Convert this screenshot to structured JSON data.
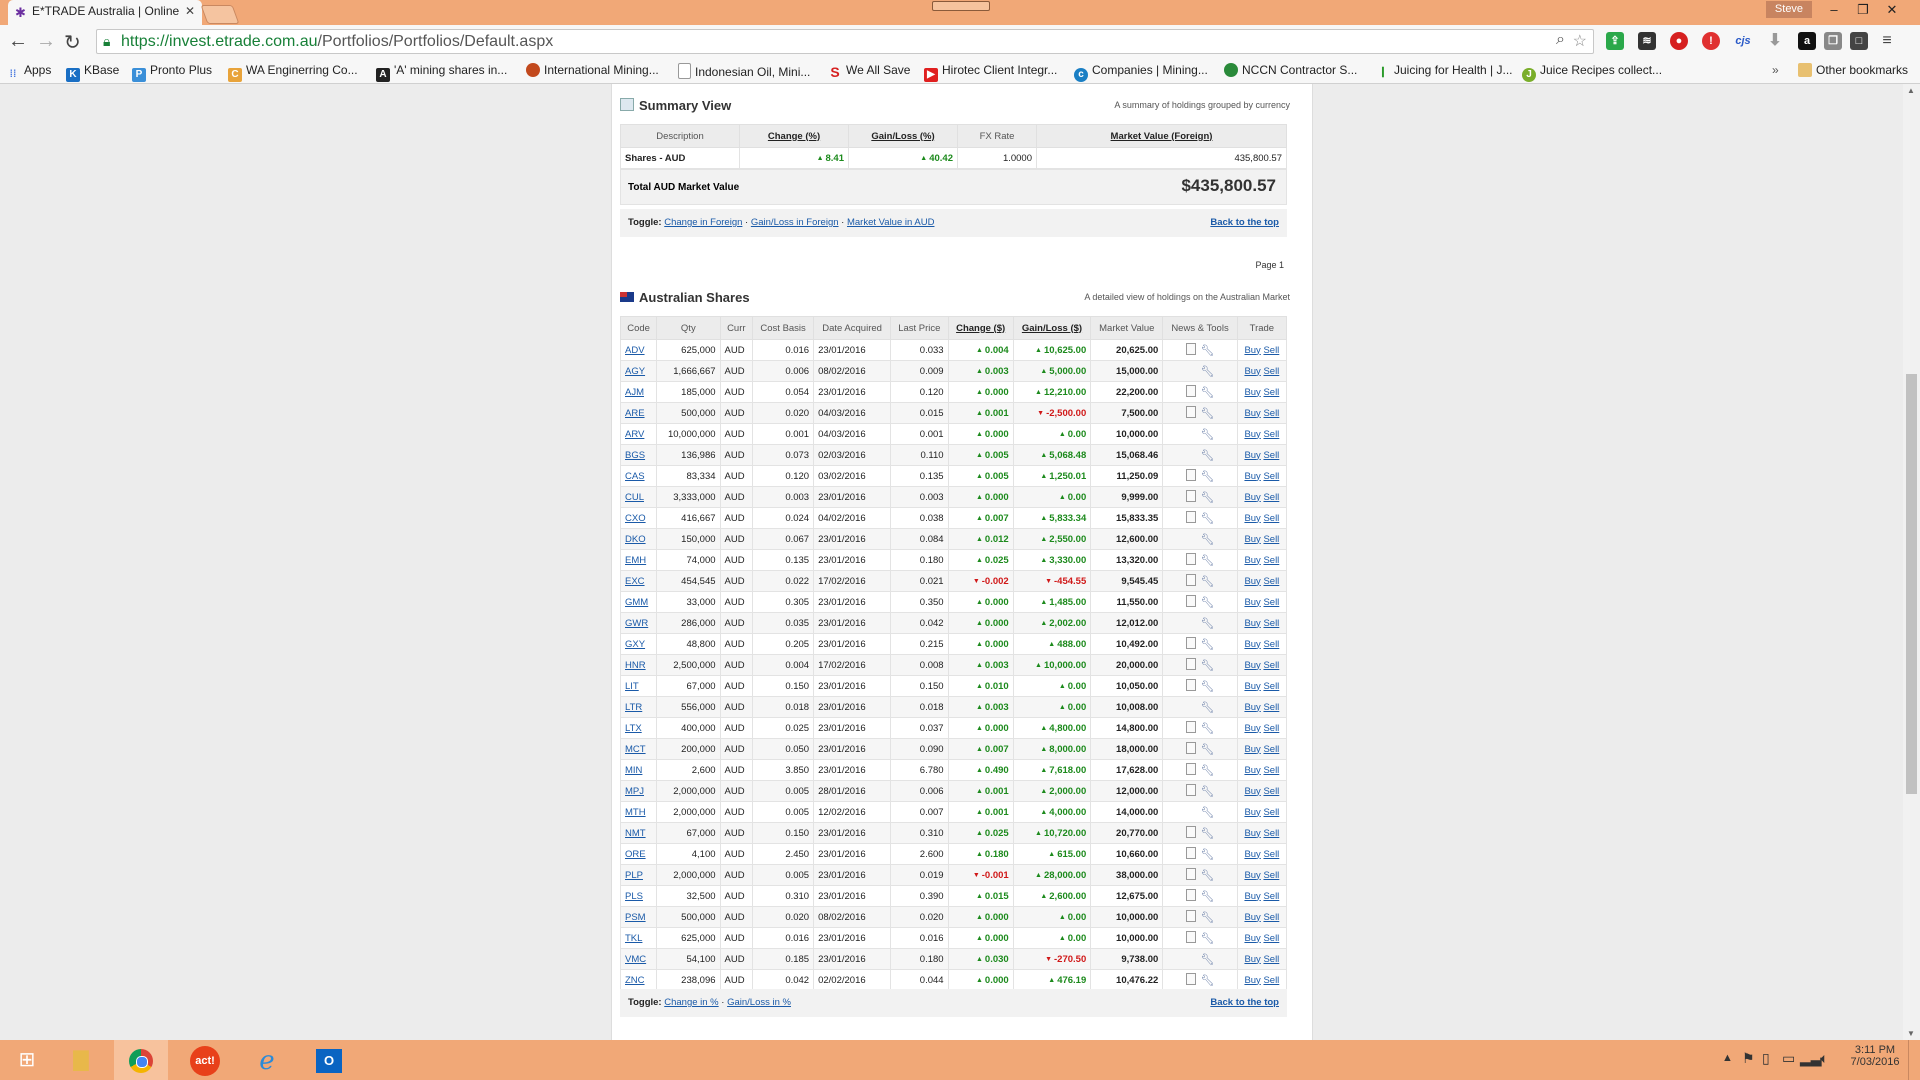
{
  "browser": {
    "tab_title": "E*TRADE Australia | Online",
    "url_host": "https://invest.etrade.com.au",
    "url_path": "/Portfolios/Portfolios/Default.aspx",
    "user": "Steve"
  },
  "bookmarks": [
    {
      "label": "Apps",
      "color": "#e94235"
    },
    {
      "label": "KBase",
      "color": "#1a6fc4"
    },
    {
      "label": "Pronto Plus",
      "color": "#3a8fd8"
    },
    {
      "label": "WA Enginerring Co...",
      "color": "#e8a33a"
    },
    {
      "label": "'A' mining shares in...",
      "color": "#222222"
    },
    {
      "label": "International Mining...",
      "color": "#c2491d"
    },
    {
      "label": "Indonesian Oil, Mini...",
      "color": "#9a9a9a"
    },
    {
      "label": "We All Save",
      "color": "#d62020"
    },
    {
      "label": "Hirotec Client Integr...",
      "color": "#e02020"
    },
    {
      "label": "Companies | Mining...",
      "color": "#1a7fc4"
    },
    {
      "label": "NCCN Contractor S...",
      "color": "#2a8a3a"
    },
    {
      "label": "Juicing for Health | J...",
      "color": "#2a9a2a"
    },
    {
      "label": "Juice Recipes collect...",
      "color": "#7aae2a"
    }
  ],
  "other_bookmarks": "Other bookmarks",
  "summary": {
    "title": "Summary View",
    "desc": "A summary of holdings grouped by currency",
    "headers": [
      "Description",
      "Change (%)",
      "Gain/Loss (%)",
      "FX Rate",
      "Market Value (Foreign)"
    ],
    "row": {
      "desc": "Shares - AUD",
      "change": "8.41",
      "gain": "40.42",
      "fx": "1.0000",
      "value": "435,800.57"
    },
    "total_label": "Total AUD Market Value",
    "total_value": "$435,800.57",
    "toggle_label": "Toggle:",
    "toggles": [
      "Change in Foreign",
      "Gain/Loss in Foreign",
      "Market Value in AUD"
    ],
    "back_top": "Back to the top"
  },
  "page_label": "Page 1",
  "shares": {
    "title": "Australian Shares",
    "desc": "A detailed view of holdings on the Australian Market",
    "headers": [
      "Code",
      "Qty",
      "Curr",
      "Cost Basis",
      "Date Acquired",
      "Last Price",
      "Change ($)",
      "Gain/Loss ($)",
      "Market Value",
      "News & Tools",
      "Trade"
    ],
    "buy_label": "Buy",
    "sell_label": "Sell",
    "rows": [
      {
        "code": "ADV",
        "qty": "625,000",
        "curr": "AUD",
        "cost": "0.016",
        "date": "23/01/2016",
        "last": "0.033",
        "change": "0.004",
        "cdir": "up",
        "gain": "10,625.00",
        "gdir": "up",
        "value": "20,625.00",
        "doc": true
      },
      {
        "code": "AGY",
        "qty": "1,666,667",
        "curr": "AUD",
        "cost": "0.006",
        "date": "08/02/2016",
        "last": "0.009",
        "change": "0.003",
        "cdir": "up",
        "gain": "5,000.00",
        "gdir": "up",
        "value": "15,000.00",
        "doc": false
      },
      {
        "code": "AJM",
        "qty": "185,000",
        "curr": "AUD",
        "cost": "0.054",
        "date": "23/01/2016",
        "last": "0.120",
        "change": "0.000",
        "cdir": "up",
        "gain": "12,210.00",
        "gdir": "up",
        "value": "22,200.00",
        "doc": true
      },
      {
        "code": "ARE",
        "qty": "500,000",
        "curr": "AUD",
        "cost": "0.020",
        "date": "04/03/2016",
        "last": "0.015",
        "change": "0.001",
        "cdir": "up",
        "gain": "-2,500.00",
        "gdir": "down",
        "value": "7,500.00",
        "doc": true
      },
      {
        "code": "ARV",
        "qty": "10,000,000",
        "curr": "AUD",
        "cost": "0.001",
        "date": "04/03/2016",
        "last": "0.001",
        "change": "0.000",
        "cdir": "up",
        "gain": "0.00",
        "gdir": "up",
        "value": "10,000.00",
        "doc": false
      },
      {
        "code": "BGS",
        "qty": "136,986",
        "curr": "AUD",
        "cost": "0.073",
        "date": "02/03/2016",
        "last": "0.110",
        "change": "0.005",
        "cdir": "up",
        "gain": "5,068.48",
        "gdir": "up",
        "value": "15,068.46",
        "doc": false
      },
      {
        "code": "CAS",
        "qty": "83,334",
        "curr": "AUD",
        "cost": "0.120",
        "date": "03/02/2016",
        "last": "0.135",
        "change": "0.005",
        "cdir": "up",
        "gain": "1,250.01",
        "gdir": "up",
        "value": "11,250.09",
        "doc": true
      },
      {
        "code": "CUL",
        "qty": "3,333,000",
        "curr": "AUD",
        "cost": "0.003",
        "date": "23/01/2016",
        "last": "0.003",
        "change": "0.000",
        "cdir": "up",
        "gain": "0.00",
        "gdir": "up",
        "value": "9,999.00",
        "doc": true
      },
      {
        "code": "CXO",
        "qty": "416,667",
        "curr": "AUD",
        "cost": "0.024",
        "date": "04/02/2016",
        "last": "0.038",
        "change": "0.007",
        "cdir": "up",
        "gain": "5,833.34",
        "gdir": "up",
        "value": "15,833.35",
        "doc": true
      },
      {
        "code": "DKO",
        "qty": "150,000",
        "curr": "AUD",
        "cost": "0.067",
        "date": "23/01/2016",
        "last": "0.084",
        "change": "0.012",
        "cdir": "up",
        "gain": "2,550.00",
        "gdir": "up",
        "value": "12,600.00",
        "doc": false
      },
      {
        "code": "EMH",
        "qty": "74,000",
        "curr": "AUD",
        "cost": "0.135",
        "date": "23/01/2016",
        "last": "0.180",
        "change": "0.025",
        "cdir": "up",
        "gain": "3,330.00",
        "gdir": "up",
        "value": "13,320.00",
        "doc": true
      },
      {
        "code": "EXC",
        "qty": "454,545",
        "curr": "AUD",
        "cost": "0.022",
        "date": "17/02/2016",
        "last": "0.021",
        "change": "-0.002",
        "cdir": "down",
        "gain": "-454.55",
        "gdir": "down",
        "value": "9,545.45",
        "doc": true
      },
      {
        "code": "GMM",
        "qty": "33,000",
        "curr": "AUD",
        "cost": "0.305",
        "date": "23/01/2016",
        "last": "0.350",
        "change": "0.000",
        "cdir": "up",
        "gain": "1,485.00",
        "gdir": "up",
        "value": "11,550.00",
        "doc": true
      },
      {
        "code": "GWR",
        "qty": "286,000",
        "curr": "AUD",
        "cost": "0.035",
        "date": "23/01/2016",
        "last": "0.042",
        "change": "0.000",
        "cdir": "up",
        "gain": "2,002.00",
        "gdir": "up",
        "value": "12,012.00",
        "doc": false
      },
      {
        "code": "GXY",
        "qty": "48,800",
        "curr": "AUD",
        "cost": "0.205",
        "date": "23/01/2016",
        "last": "0.215",
        "change": "0.000",
        "cdir": "up",
        "gain": "488.00",
        "gdir": "up",
        "value": "10,492.00",
        "doc": true
      },
      {
        "code": "HNR",
        "qty": "2,500,000",
        "curr": "AUD",
        "cost": "0.004",
        "date": "17/02/2016",
        "last": "0.008",
        "change": "0.003",
        "cdir": "up",
        "gain": "10,000.00",
        "gdir": "up",
        "value": "20,000.00",
        "doc": true
      },
      {
        "code": "LIT",
        "qty": "67,000",
        "curr": "AUD",
        "cost": "0.150",
        "date": "23/01/2016",
        "last": "0.150",
        "change": "0.010",
        "cdir": "up",
        "gain": "0.00",
        "gdir": "up",
        "value": "10,050.00",
        "doc": true
      },
      {
        "code": "LTR",
        "qty": "556,000",
        "curr": "AUD",
        "cost": "0.018",
        "date": "23/01/2016",
        "last": "0.018",
        "change": "0.003",
        "cdir": "up",
        "gain": "0.00",
        "gdir": "up",
        "value": "10,008.00",
        "doc": false
      },
      {
        "code": "LTX",
        "qty": "400,000",
        "curr": "AUD",
        "cost": "0.025",
        "date": "23/01/2016",
        "last": "0.037",
        "change": "0.000",
        "cdir": "up",
        "gain": "4,800.00",
        "gdir": "up",
        "value": "14,800.00",
        "doc": true
      },
      {
        "code": "MCT",
        "qty": "200,000",
        "curr": "AUD",
        "cost": "0.050",
        "date": "23/01/2016",
        "last": "0.090",
        "change": "0.007",
        "cdir": "up",
        "gain": "8,000.00",
        "gdir": "up",
        "value": "18,000.00",
        "doc": true
      },
      {
        "code": "MIN",
        "qty": "2,600",
        "curr": "AUD",
        "cost": "3.850",
        "date": "23/01/2016",
        "last": "6.780",
        "change": "0.490",
        "cdir": "up",
        "gain": "7,618.00",
        "gdir": "up",
        "value": "17,628.00",
        "doc": true
      },
      {
        "code": "MPJ",
        "qty": "2,000,000",
        "curr": "AUD",
        "cost": "0.005",
        "date": "28/01/2016",
        "last": "0.006",
        "change": "0.001",
        "cdir": "up",
        "gain": "2,000.00",
        "gdir": "up",
        "value": "12,000.00",
        "doc": true
      },
      {
        "code": "MTH",
        "qty": "2,000,000",
        "curr": "AUD",
        "cost": "0.005",
        "date": "12/02/2016",
        "last": "0.007",
        "change": "0.001",
        "cdir": "up",
        "gain": "4,000.00",
        "gdir": "up",
        "value": "14,000.00",
        "doc": false
      },
      {
        "code": "NMT",
        "qty": "67,000",
        "curr": "AUD",
        "cost": "0.150",
        "date": "23/01/2016",
        "last": "0.310",
        "change": "0.025",
        "cdir": "up",
        "gain": "10,720.00",
        "gdir": "up",
        "value": "20,770.00",
        "doc": true
      },
      {
        "code": "ORE",
        "qty": "4,100",
        "curr": "AUD",
        "cost": "2.450",
        "date": "23/01/2016",
        "last": "2.600",
        "change": "0.180",
        "cdir": "up",
        "gain": "615.00",
        "gdir": "up",
        "value": "10,660.00",
        "doc": true
      },
      {
        "code": "PLP",
        "qty": "2,000,000",
        "curr": "AUD",
        "cost": "0.005",
        "date": "23/01/2016",
        "last": "0.019",
        "change": "-0.001",
        "cdir": "down",
        "gain": "28,000.00",
        "gdir": "up",
        "value": "38,000.00",
        "doc": true
      },
      {
        "code": "PLS",
        "qty": "32,500",
        "curr": "AUD",
        "cost": "0.310",
        "date": "23/01/2016",
        "last": "0.390",
        "change": "0.015",
        "cdir": "up",
        "gain": "2,600.00",
        "gdir": "up",
        "value": "12,675.00",
        "doc": true
      },
      {
        "code": "PSM",
        "qty": "500,000",
        "curr": "AUD",
        "cost": "0.020",
        "date": "08/02/2016",
        "last": "0.020",
        "change": "0.000",
        "cdir": "up",
        "gain": "0.00",
        "gdir": "up",
        "value": "10,000.00",
        "doc": true
      },
      {
        "code": "TKL",
        "qty": "625,000",
        "curr": "AUD",
        "cost": "0.016",
        "date": "23/01/2016",
        "last": "0.016",
        "change": "0.000",
        "cdir": "up",
        "gain": "0.00",
        "gdir": "up",
        "value": "10,000.00",
        "doc": true
      },
      {
        "code": "VMC",
        "qty": "54,100",
        "curr": "AUD",
        "cost": "0.185",
        "date": "23/01/2016",
        "last": "0.180",
        "change": "0.030",
        "cdir": "up",
        "gain": "-270.50",
        "gdir": "down",
        "value": "9,738.00",
        "doc": false
      },
      {
        "code": "ZNC",
        "qty": "238,096",
        "curr": "AUD",
        "cost": "0.042",
        "date": "02/02/2016",
        "last": "0.044",
        "change": "0.000",
        "cdir": "up",
        "gain": "476.19",
        "gdir": "up",
        "value": "10,476.22",
        "doc": true
      }
    ],
    "toggle_label": "Toggle:",
    "toggles": [
      "Change in %",
      "Gain/Loss in %"
    ],
    "back_top": "Back to the top"
  },
  "clock": {
    "time": "3:11 PM",
    "date": "7/03/2016"
  },
  "icons": {
    "etrade": "etrade-icon",
    "back": "back-arrow-icon",
    "forward": "forward-arrow-icon",
    "reload": "reload-icon",
    "lock": "lock-icon",
    "zoom": "zoom-icon",
    "star": "star-icon",
    "wrench": "wrench-icon",
    "doc": "document-icon",
    "start": "windows-start-icon",
    "folder": "folder-icon",
    "chrome": "chrome-icon",
    "act": "act-icon",
    "ie": "ie-icon",
    "outlook": "outlook-icon"
  },
  "act_label": "act!",
  "ext_labels": {
    "cjs": "cjs",
    "amazon": "a"
  },
  "colors": {
    "accent": "#f1a877",
    "link": "#1a5aa8",
    "positive": "#1c8a1c",
    "negative": "#d01818"
  }
}
